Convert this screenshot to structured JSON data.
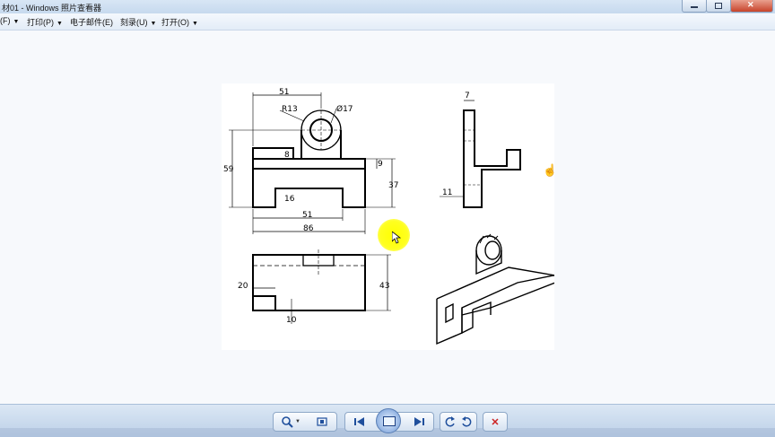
{
  "window": {
    "title": "材01 - Windows 照片查看器"
  },
  "menu": [
    {
      "label": "(F)"
    },
    {
      "label": "打印(P)"
    },
    {
      "label": "电子邮件(E)"
    },
    {
      "label": "刻录(U)"
    },
    {
      "label": "打开(O)"
    }
  ],
  "drawing": {
    "dimensions": {
      "front_width_top": "51",
      "radius": "R13",
      "hole": "Ø17",
      "lug": "8",
      "total_height": "59",
      "step": "9",
      "right_height": "37",
      "slot_depth": "16",
      "slot_width": "51",
      "base_width": "86",
      "plan_notch": "20",
      "plan_depth": "43",
      "plan_small": "10",
      "side_top": "7",
      "side_bottom": "11"
    }
  },
  "toolbar": {
    "zoom_icon": "magnifier-icon",
    "fit_icon": "actual-size-icon",
    "prev_icon": "previous-icon",
    "slideshow_icon": "slideshow-icon",
    "next_icon": "next-icon",
    "rotate_ccw_icon": "rotate-counterclockwise-icon",
    "rotate_cw_icon": "rotate-clockwise-icon",
    "delete_icon": "delete-icon",
    "accent_color": "#1f4f9c",
    "delete_color": "#cc2222"
  }
}
